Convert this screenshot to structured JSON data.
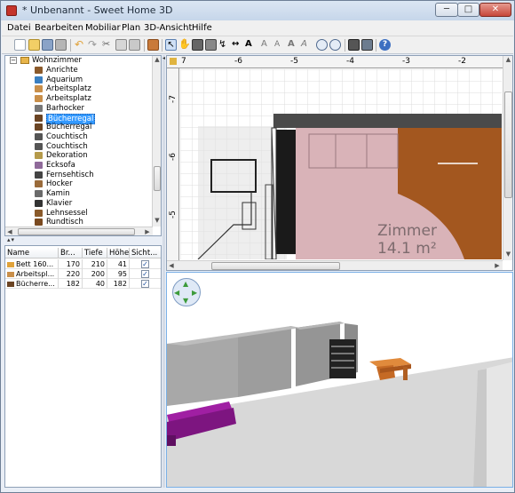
{
  "window": {
    "title": "* Unbenannt - Sweet Home 3D",
    "minimize": "─",
    "maximize": "□",
    "close": "✕"
  },
  "menu": [
    "Datei",
    "Bearbeiten",
    "Mobiliar",
    "Plan",
    "3D-Ansicht",
    "Hilfe"
  ],
  "toolbar_icons": [
    "new-icon",
    "open-icon",
    "save-icon",
    "cut-prefs-icon",
    "undo-icon",
    "redo-icon",
    "cut-icon",
    "copy-icon",
    "paste-icon",
    "add-furniture-icon",
    "select-icon",
    "pan-icon",
    "create-walls-icon",
    "create-rooms-icon",
    "create-polylines-icon",
    "create-dimensions-icon",
    "add-text-icon",
    "increase-text-icon",
    "decrease-text-icon",
    "bold-text-icon",
    "italic-text-icon",
    "zoom-in-icon",
    "zoom-out-icon",
    "create-photo-icon",
    "create-video-icon",
    "help-icon"
  ],
  "catalog": {
    "category": "Wohnzimmer",
    "items": [
      "Anrichte",
      "Aquarium",
      "Arbeitsplatz",
      "Arbeitsplatz",
      "Barhocker",
      "Bücherregal",
      "Bücherregal",
      "Couchtisch",
      "Couchtisch",
      "Dekoration",
      "Ecksofa",
      "Fernsehtisch",
      "Hocker",
      "Kamin",
      "Klavier",
      "Lehnsessel",
      "Rundtisch"
    ],
    "selected_index": 5
  },
  "furniture_table": {
    "headers": [
      "Name",
      "Br...",
      "Tiefe",
      "Höhe",
      "Sicht..."
    ],
    "rows": [
      {
        "name": "Bett 160...",
        "width": "170",
        "depth": "210",
        "height": "41",
        "visible": "✓"
      },
      {
        "name": "Arbeitspl...",
        "width": "220",
        "depth": "200",
        "height": "95",
        "visible": "✓"
      },
      {
        "name": "Bücherre...",
        "width": "182",
        "depth": "40",
        "height": "182",
        "visible": "✓"
      }
    ]
  },
  "plan": {
    "ruler_x": [
      "7",
      "-6",
      "-5",
      "-4",
      "-3",
      "-2"
    ],
    "ruler_y": [
      "-7",
      "-6",
      "-5"
    ],
    "room_name": "Zimmer",
    "room_area": "14.1 m²",
    "colors": {
      "room_pink": "#d9b3b8",
      "floor_brown": "#a3571f",
      "grid": "#d0d0d0",
      "wall_dark": "#4a4a4a"
    }
  },
  "view3d": {
    "colors": {
      "sky": "#ffffff",
      "ground": "#d6d6d6",
      "wall": "#9a9a9a",
      "sofa": "#9c1a9c",
      "table": "#d97a33"
    }
  }
}
